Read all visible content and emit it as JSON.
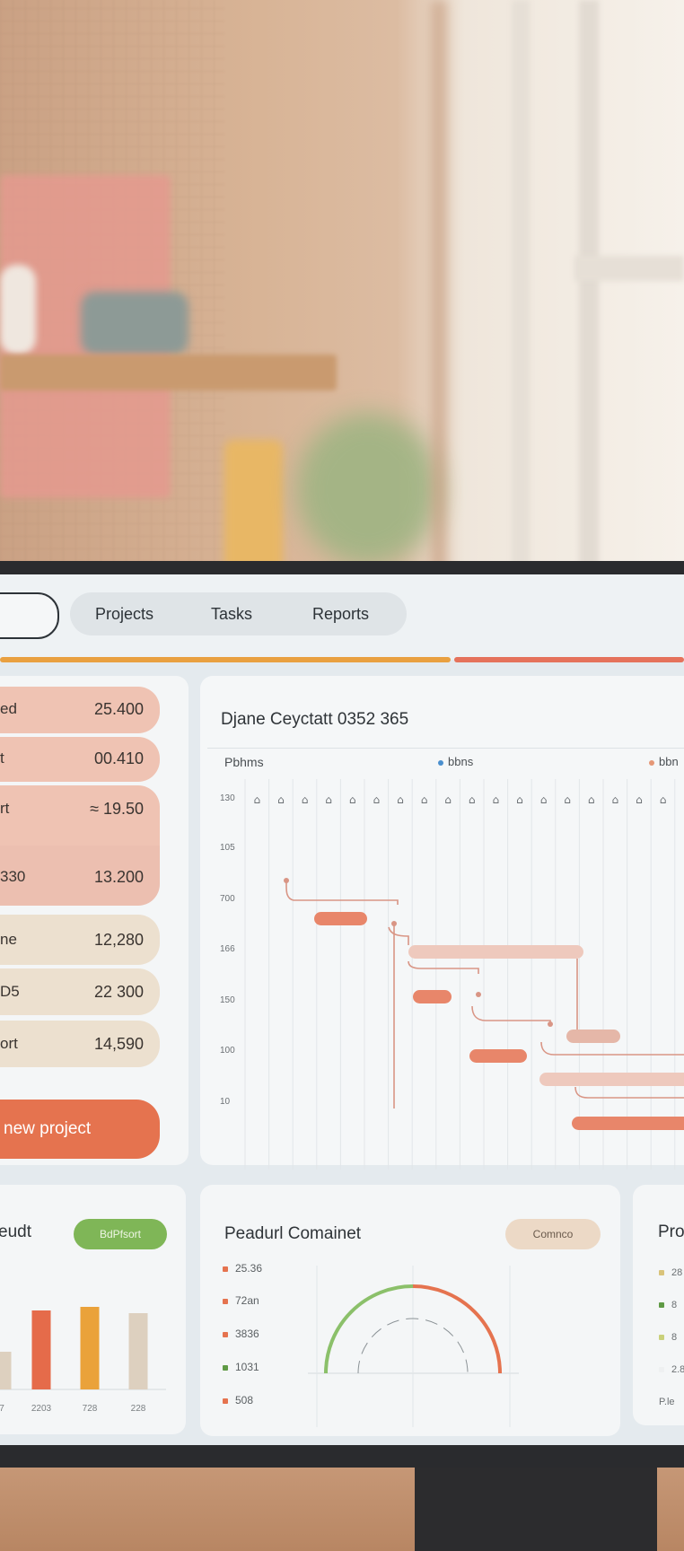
{
  "nav": {
    "tabs": [
      {
        "label": "Projects"
      },
      {
        "label": "Tasks"
      },
      {
        "label": "Reports"
      }
    ]
  },
  "projects": [
    {
      "name": "ed",
      "value": "25.400",
      "color": "#efc3b3"
    },
    {
      "name": "t",
      "value": "00.410",
      "color": "#efc3b3"
    },
    {
      "name": "rt",
      "value": "≈ 19.50",
      "color": "#efc3b3"
    },
    {
      "name": "330",
      "value": "13.200",
      "color": "#ecbfb0"
    },
    {
      "name": "ne",
      "value": "12,280",
      "color": "#ece0cf"
    },
    {
      "name": "D5",
      "value": "22 300",
      "color": "#ece0cf"
    },
    {
      "name": "ort",
      "value": "14,590",
      "color": "#ece0cf"
    }
  ],
  "new_project_label": "new project",
  "gantt": {
    "title": "Djane Ceyctatt 0352 365",
    "column_header": "Pbhms",
    "legend": [
      {
        "label": "bbns",
        "color": "#4a8fce"
      },
      {
        "label": "bbn",
        "color": "#e59776"
      }
    ],
    "row_labels": [
      "130",
      "105",
      "700",
      "166",
      "150",
      "100",
      "10"
    ],
    "day_icons": [
      "⌂",
      "⌂",
      "⌂",
      "⌂",
      "⌂",
      "⌂",
      "⌂",
      "⌂",
      "⌂",
      "⌂",
      "⌂",
      "⌂",
      "⌂",
      "⌂",
      "⌂",
      "⌂",
      "⌂",
      "⌂"
    ]
  },
  "budget": {
    "title": "eudt",
    "pill_label": "BdPfsort",
    "bar_labels": [
      "7",
      "2203",
      "728",
      "228"
    ],
    "chart_data": {
      "type": "bar",
      "categories": [
        "7",
        "2203",
        "728",
        "228"
      ],
      "values": [
        42,
        88,
        92,
        85
      ],
      "colors": [
        "#ddd0bf",
        "#e56b4a",
        "#eaa23a",
        "#ddd0bf"
      ]
    }
  },
  "resource": {
    "title": "Peadurl Comainet",
    "pill_label": "Comnco",
    "metrics": [
      {
        "label": "25.36",
        "color": "#e5734f"
      },
      {
        "label": "72an",
        "color": "#e5734f"
      },
      {
        "label": "3836",
        "color": "#e5734f"
      },
      {
        "label": "1031",
        "color": "#5f9a45"
      },
      {
        "label": "508",
        "color": "#e5734f"
      }
    ],
    "gauge": {
      "green_color": "#8bc06a",
      "red_color": "#e5734f"
    }
  },
  "right_panel": {
    "title": "Pro",
    "rows": [
      {
        "label": "28",
        "color": "#d9c37a"
      },
      {
        "label": "8",
        "color": "#5f9a45"
      },
      {
        "label": "8",
        "color": "#c9d07a"
      },
      {
        "label": "2.8",
        "color": "#eef0f1"
      }
    ],
    "footer": "P.le"
  }
}
